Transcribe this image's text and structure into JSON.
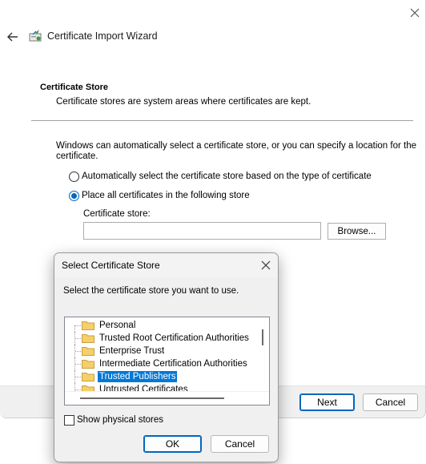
{
  "wizard": {
    "title": "Certificate Import Wizard",
    "section_title": "Certificate Store",
    "section_desc": "Certificate stores are system areas where certificates are kept.",
    "intro": "Windows can automatically select a certificate store, or you can specify a location for the certificate.",
    "radio_auto": "Automatically select the certificate store based on the type of certificate",
    "radio_place": "Place all certificates in the following store",
    "store_label": "Certificate store:",
    "store_value": "",
    "browse_label": "Browse...",
    "next_label": "Next",
    "cancel_label": "Cancel",
    "selected_option": "place"
  },
  "dialog": {
    "title": "Select Certificate Store",
    "prompt": "Select the certificate store you want to use.",
    "stores": [
      {
        "label": "Personal",
        "selected": false
      },
      {
        "label": "Trusted Root Certification Authorities",
        "selected": false
      },
      {
        "label": "Enterprise Trust",
        "selected": false
      },
      {
        "label": "Intermediate Certification Authorities",
        "selected": false
      },
      {
        "label": "Trusted Publishers",
        "selected": true
      },
      {
        "label": "Untrusted Certificates",
        "selected": false
      }
    ],
    "show_physical_label": "Show physical stores",
    "show_physical_checked": false,
    "ok_label": "OK",
    "cancel_label": "Cancel"
  },
  "icons": {
    "close": "close-icon",
    "back": "back-arrow-icon",
    "wizard": "certificate-icon",
    "folder": "folder-icon"
  },
  "colors": {
    "accent": "#0067c0",
    "selection": "#0078d7",
    "folder": "#f5cf6a"
  }
}
